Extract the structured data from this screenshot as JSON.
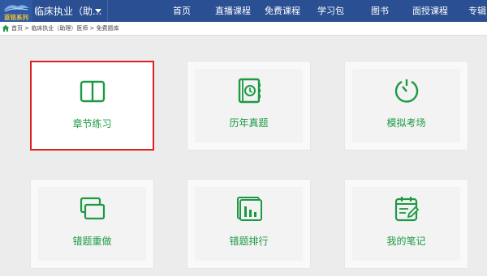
{
  "header": {
    "logo_text": "蓝铭系列",
    "category": "临床执业（助...",
    "nav": [
      "首页",
      "直播课程",
      "免费课程",
      "学习包",
      "图书",
      "面授课程",
      "专辑"
    ]
  },
  "breadcrumb": "首页 > 临床执业（助理）医师 > 免费题库",
  "tiles": [
    {
      "label": "章节练习",
      "icon": "book-icon",
      "selected": true
    },
    {
      "label": "历年真题",
      "icon": "binder-clock-icon"
    },
    {
      "label": "模拟考场",
      "icon": "timer-icon"
    },
    {
      "label": "错题重做",
      "icon": "stacked-cards-icon"
    },
    {
      "label": "错题排行",
      "icon": "bar-ranking-icon"
    },
    {
      "label": "我的笔记",
      "icon": "notepad-pen-icon"
    }
  ],
  "colors": {
    "nav_bg": "#2a4f93",
    "accent_green": "#1c9a43",
    "selected_border": "#e02020"
  }
}
